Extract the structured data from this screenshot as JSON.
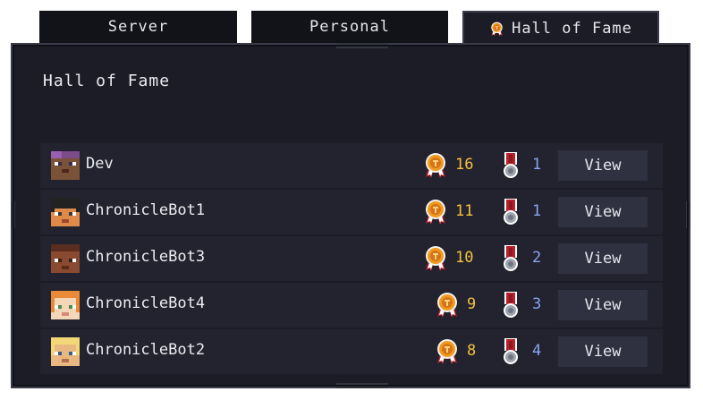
{
  "tabs": [
    {
      "label": "Server",
      "active": false
    },
    {
      "label": "Personal",
      "active": false
    },
    {
      "label": "Hall of Fame",
      "active": true,
      "icon": "gold-medal-icon"
    }
  ],
  "panel": {
    "title": "Hall of Fame"
  },
  "colors": {
    "gold_count": "#f4c13e",
    "silver_count": "#8aa4f0",
    "row_bg": "#22232e",
    "button_bg": "#2f3140"
  },
  "players": [
    {
      "name": "Dev",
      "gold": "16",
      "silver": "1",
      "button": "View",
      "skin": "purple-hair"
    },
    {
      "name": "ChronicleBot1",
      "gold": "11",
      "silver": "1",
      "button": "View",
      "skin": "black-hair"
    },
    {
      "name": "ChronicleBot3",
      "gold": "10",
      "silver": "2",
      "button": "View",
      "skin": "brown-hair"
    },
    {
      "name": "ChronicleBot4",
      "gold": "9",
      "silver": "3",
      "button": "View",
      "skin": "orange-hair"
    },
    {
      "name": "ChronicleBot2",
      "gold": "8",
      "silver": "4",
      "button": "View",
      "skin": "blonde-hair"
    }
  ]
}
